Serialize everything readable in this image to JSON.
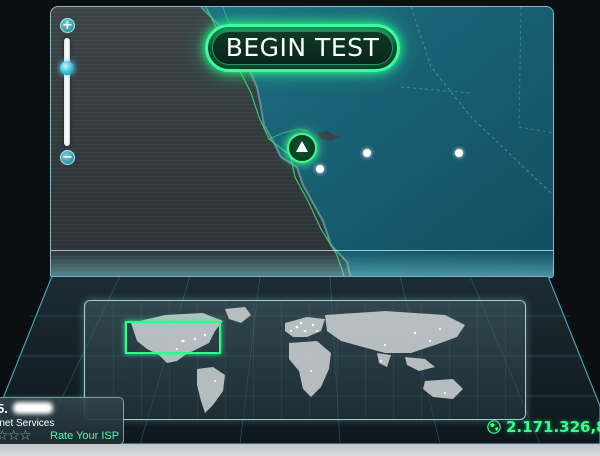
{
  "main": {
    "begin_button_label": "BEGIN TEST"
  },
  "zoom": {
    "plus": "+",
    "minus": "−",
    "level": 0.78
  },
  "isp": {
    "ip_prefix": "5.",
    "name": "rnet Services",
    "stars": "☆☆☆",
    "rating": 0,
    "rate_label": "Rate Your ISP"
  },
  "stats": {
    "tests_count": "2.171.326,8"
  },
  "colors": {
    "accent": "#36ff8e",
    "panel_border": "#aae6eb"
  }
}
